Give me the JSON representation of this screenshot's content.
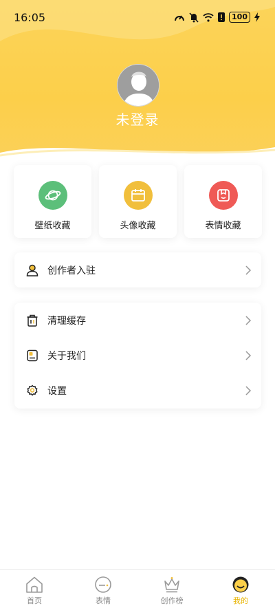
{
  "status_bar": {
    "time": "16:05",
    "battery": "100"
  },
  "profile": {
    "login_label": "未登录"
  },
  "favorites": [
    {
      "label": "壁纸收藏",
      "icon": "planet-icon",
      "color": "#5cbf7a"
    },
    {
      "label": "头像收藏",
      "icon": "calendar-icon",
      "color": "#f1bf3c"
    },
    {
      "label": "表情收藏",
      "icon": "emoji-box-icon",
      "color": "#ef5a56"
    }
  ],
  "creator": {
    "label": "创作者入驻",
    "icon": "user-icon"
  },
  "settings_list": [
    {
      "label": "清理缓存",
      "icon": "trash-icon"
    },
    {
      "label": "关于我们",
      "icon": "info-card-icon"
    },
    {
      "label": "设置",
      "icon": "gear-icon"
    }
  ],
  "bottom_nav": [
    {
      "label": "首页",
      "icon": "home-icon",
      "active": false
    },
    {
      "label": "表情",
      "icon": "emoji-icon",
      "active": false
    },
    {
      "label": "创作榜",
      "icon": "crown-icon",
      "active": false
    },
    {
      "label": "我的",
      "icon": "smile-icon",
      "active": true
    }
  ],
  "colors": {
    "accent": "#fcd04a",
    "active_tab": "#e8b400"
  }
}
